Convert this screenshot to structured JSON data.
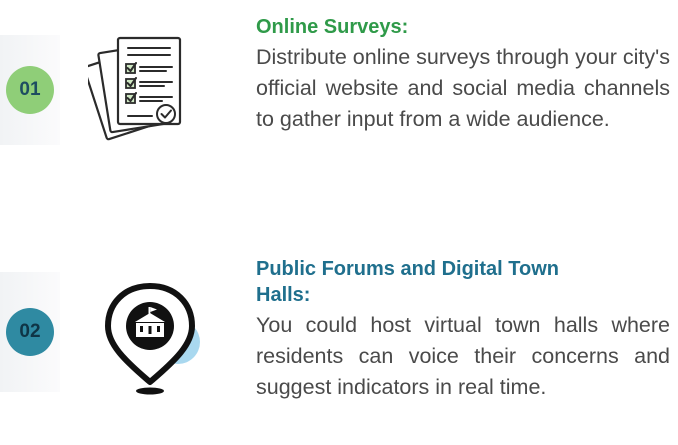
{
  "items": [
    {
      "number": "01",
      "icon": "survey-documents-icon",
      "heading": "Online Surveys:",
      "body": "Distribute online surveys through your city's official website and social media channels to gather input from a wide audience.",
      "accent": "#2f9a49",
      "badge_color": "#8fce78"
    },
    {
      "number": "02",
      "icon": "town-hall-location-pin-icon",
      "heading": "Public Forums and Digital Town Halls:",
      "body": "You could host virtual town halls where residents can voice their concerns and suggest indicators in real time.",
      "accent": "#1f6f8d",
      "badge_color": "#2f8aa2"
    }
  ]
}
